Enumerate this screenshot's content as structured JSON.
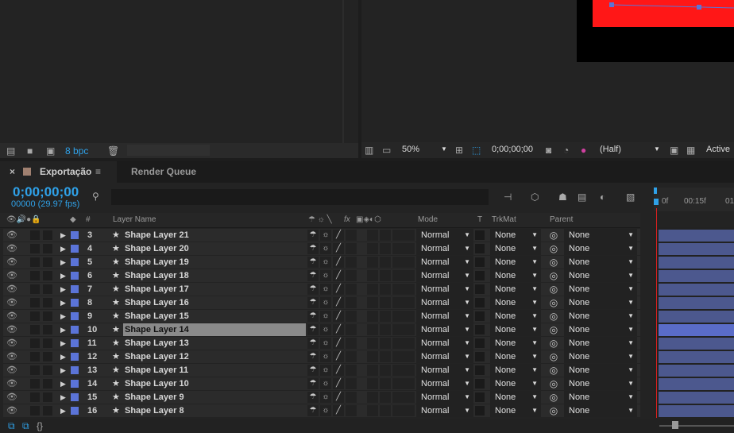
{
  "project": {
    "bpc": "8 bpc"
  },
  "comp": {
    "zoom": "50%",
    "timecode": "0;00;00;00",
    "resolution": "(Half)",
    "view": "Active"
  },
  "timeline": {
    "tabs": [
      {
        "label": "Exportação"
      },
      {
        "label": "Render Queue"
      }
    ],
    "timecode": "0;00;00;00",
    "fps": "00000 (29.97 fps)",
    "ruler": [
      "0f",
      "00:15f",
      "01"
    ],
    "headers": {
      "hash": "#",
      "layer_name": "Layer Name",
      "mode": "Mode",
      "t": "T",
      "trkmat": "TrkMat",
      "parent": "Parent",
      "fx": "fx"
    },
    "layers": [
      {
        "num": "3",
        "name": "Shape Layer 21",
        "mode": "Normal",
        "trkmat": "None",
        "parent": "None"
      },
      {
        "num": "4",
        "name": "Shape Layer 20",
        "mode": "Normal",
        "trkmat": "None",
        "parent": "None"
      },
      {
        "num": "5",
        "name": "Shape Layer 19",
        "mode": "Normal",
        "trkmat": "None",
        "parent": "None"
      },
      {
        "num": "6",
        "name": "Shape Layer 18",
        "mode": "Normal",
        "trkmat": "None",
        "parent": "None"
      },
      {
        "num": "7",
        "name": "Shape Layer 17",
        "mode": "Normal",
        "trkmat": "None",
        "parent": "None"
      },
      {
        "num": "8",
        "name": "Shape Layer 16",
        "mode": "Normal",
        "trkmat": "None",
        "parent": "None"
      },
      {
        "num": "9",
        "name": "Shape Layer 15",
        "mode": "Normal",
        "trkmat": "None",
        "parent": "None"
      },
      {
        "num": "10",
        "name": "Shape Layer 14",
        "mode": "Normal",
        "trkmat": "None",
        "parent": "None",
        "selected": true
      },
      {
        "num": "11",
        "name": "Shape Layer 13",
        "mode": "Normal",
        "trkmat": "None",
        "parent": "None"
      },
      {
        "num": "12",
        "name": "Shape Layer 12",
        "mode": "Normal",
        "trkmat": "None",
        "parent": "None"
      },
      {
        "num": "13",
        "name": "Shape Layer 11",
        "mode": "Normal",
        "trkmat": "None",
        "parent": "None"
      },
      {
        "num": "14",
        "name": "Shape Layer 10",
        "mode": "Normal",
        "trkmat": "None",
        "parent": "None"
      },
      {
        "num": "15",
        "name": "Shape Layer 9",
        "mode": "Normal",
        "trkmat": "None",
        "parent": "None"
      },
      {
        "num": "16",
        "name": "Shape Layer 8",
        "mode": "Normal",
        "trkmat": "None",
        "parent": "None"
      }
    ]
  },
  "colors": {
    "label": "#5b74d8",
    "timecode": "#2fa1e8",
    "bar": "#4c588e",
    "cti": "#d92020"
  }
}
